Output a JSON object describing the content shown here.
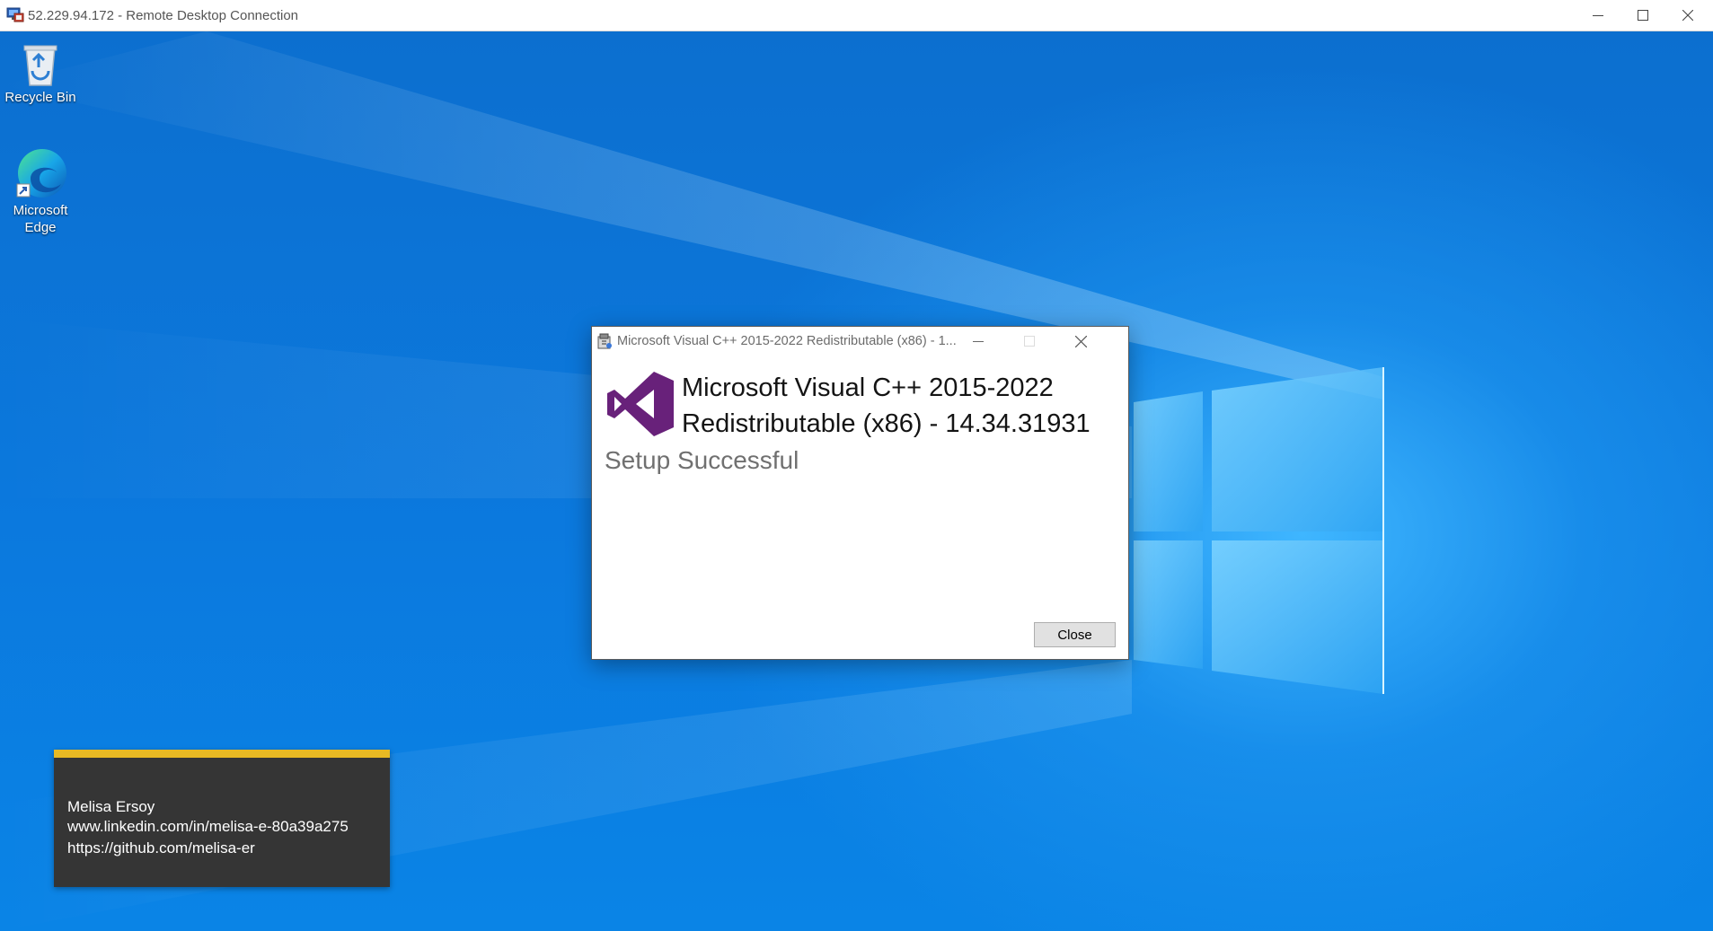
{
  "rdp_window": {
    "title": "52.229.94.172 - Remote Desktop Connection",
    "icon": "remote-desktop-icon",
    "controls": [
      "minimize-icon",
      "maximize-icon",
      "close-icon"
    ]
  },
  "desktop": {
    "icons": [
      {
        "label": "Recycle Bin",
        "icon": "recycle-bin-icon"
      },
      {
        "label": "Microsoft Edge",
        "icon": "edge-icon"
      }
    ]
  },
  "dialog": {
    "title": "Microsoft Visual C++ 2015-2022 Redistributable (x86) - 1...",
    "product_line1": "Microsoft Visual C++ 2015-2022",
    "product_line2": "Redistributable (x86) - 14.34.31931",
    "status": "Setup Successful",
    "close_button": "Close",
    "logo": "visual-studio-logo",
    "accent_color": "#68217a"
  },
  "overlay": {
    "name": "Melisa Ersoy",
    "linkedin": "www.linkedin.com/in/melisa-e-80a39a275",
    "github": "https://github.com/melisa-er",
    "accent_color": "#e8b923"
  }
}
